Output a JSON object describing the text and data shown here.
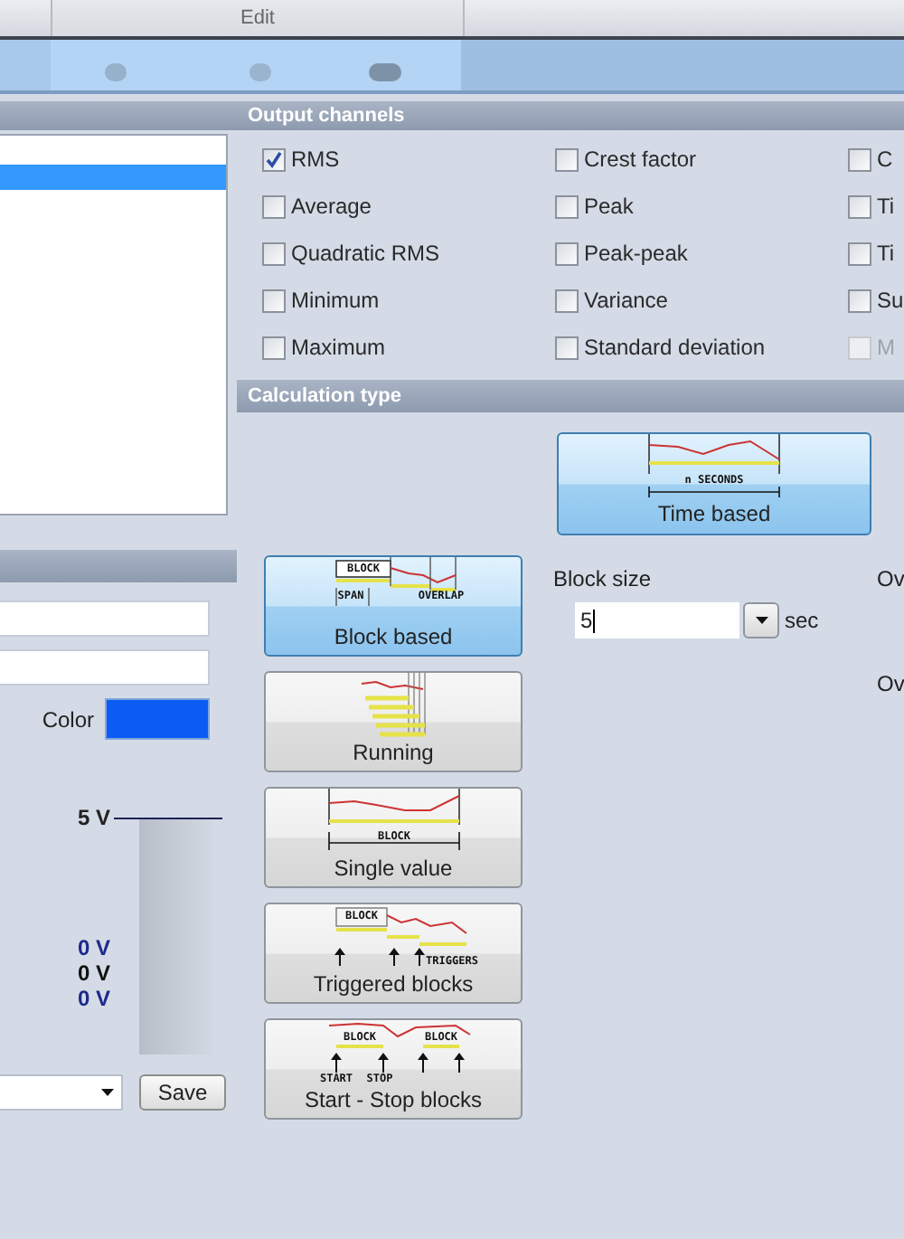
{
  "tab_strip": {
    "tabs": [
      {
        "label": "Edit",
        "selected": false
      }
    ]
  },
  "left_panel": {
    "list_rows": [
      {
        "selected": false
      },
      {
        "selected": true
      }
    ],
    "color_swatch": {
      "label": "Color",
      "color": "#0b5cf5"
    },
    "scale": {
      "top": "5 V",
      "readings": [
        {
          "text": "0 V",
          "color": "#1c2a8c"
        },
        {
          "text": "0 V",
          "color": "#111111"
        },
        {
          "text": "0 V",
          "color": "#1c2a8c"
        }
      ]
    },
    "save_button": "Save"
  },
  "output_channels": {
    "title": "Output channels",
    "options": [
      {
        "label": "RMS",
        "checked": true,
        "disabled": false
      },
      {
        "label": "Crest factor",
        "checked": false,
        "disabled": false
      },
      {
        "label": "C",
        "checked": false,
        "disabled": false
      },
      {
        "label": "Average",
        "checked": false,
        "disabled": false
      },
      {
        "label": "Peak",
        "checked": false,
        "disabled": false
      },
      {
        "label": "Ti",
        "checked": false,
        "disabled": false
      },
      {
        "label": "Quadratic RMS",
        "checked": false,
        "disabled": false
      },
      {
        "label": "Peak-peak",
        "checked": false,
        "disabled": false
      },
      {
        "label": "Ti",
        "checked": false,
        "disabled": false
      },
      {
        "label": "Minimum",
        "checked": false,
        "disabled": false
      },
      {
        "label": "Variance",
        "checked": false,
        "disabled": false
      },
      {
        "label": "Su",
        "checked": false,
        "disabled": false
      },
      {
        "label": "Maximum",
        "checked": false,
        "disabled": false
      },
      {
        "label": "Standard deviation",
        "checked": false,
        "disabled": false
      },
      {
        "label": "M",
        "checked": false,
        "disabled": true
      }
    ]
  },
  "calculation_type": {
    "title": "Calculation type",
    "modes": [
      {
        "label": "Time based",
        "kind": "time",
        "selected": true,
        "diagram_labels": [
          "n SECONDS"
        ]
      },
      {
        "label": "Block based",
        "kind": "block",
        "selected": true,
        "diagram_labels": [
          "BLOCK",
          "SPAN",
          "OVERLAP"
        ]
      },
      {
        "label": "Running",
        "kind": "running",
        "selected": false
      },
      {
        "label": "Single value",
        "kind": "single",
        "selected": false,
        "diagram_labels": [
          "BLOCK"
        ]
      },
      {
        "label": "Triggered blocks",
        "kind": "triggered",
        "selected": false,
        "diagram_labels": [
          "BLOCK",
          "TRIGGERS"
        ]
      },
      {
        "label": "Start - Stop blocks",
        "kind": "startstop",
        "selected": false,
        "diagram_labels": [
          "BLOCK",
          "BLOCK",
          "START",
          "STOP"
        ]
      }
    ],
    "block_size": {
      "label": "Block size",
      "value": "5",
      "unit": "sec"
    },
    "overlap_labels": [
      "Ov",
      "Ov"
    ]
  }
}
